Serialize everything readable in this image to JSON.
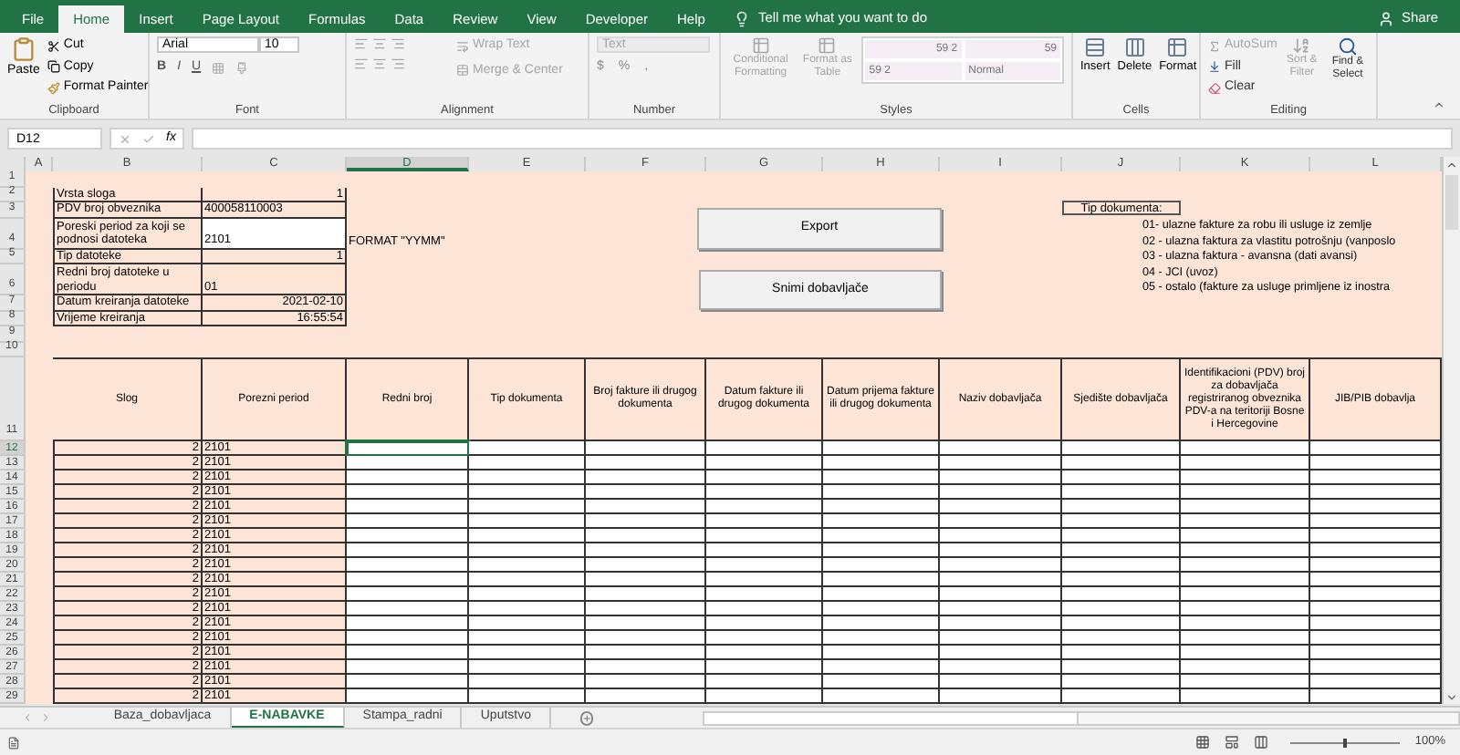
{
  "menu": [
    {
      "label": "File",
      "selected": false
    },
    {
      "label": "Home",
      "selected": true
    },
    {
      "label": "Insert",
      "selected": false
    },
    {
      "label": "Page Layout",
      "selected": false
    },
    {
      "label": "Formulas",
      "selected": false
    },
    {
      "label": "Data",
      "selected": false
    },
    {
      "label": "Review",
      "selected": false
    },
    {
      "label": "View",
      "selected": false
    },
    {
      "label": "Developer",
      "selected": false
    },
    {
      "label": "Help",
      "selected": false
    }
  ],
  "tell_me": "Tell me what you want to do",
  "share": "Share",
  "clipboard": {
    "label": "Clipboard",
    "paste": "Paste",
    "cut": "Cut",
    "copy": "Copy",
    "format_painter": "Format Painter"
  },
  "font": {
    "label": "Font",
    "name": "Arial",
    "size": "10",
    "bold": "B",
    "italic": "I",
    "underline": "U"
  },
  "alignment": {
    "label": "Alignment",
    "wrap_text": {
      "label": "Wrap Text",
      "disabled": true
    },
    "merge": {
      "label": "Merge & Center",
      "disabled": true
    }
  },
  "number": {
    "label": "Number",
    "format": {
      "label": "Text",
      "disabled": true
    },
    "currency": "$",
    "percent": "%",
    "comma": ","
  },
  "styles": {
    "label": "Styles",
    "conditional": {
      "label": "Conditional Formatting",
      "disabled": true
    },
    "format_table": {
      "label": "Format as Table",
      "disabled": true
    },
    "gallery": [
      "59 2",
      "59",
      "59 2",
      "Normal"
    ]
  },
  "cells": {
    "label": "Cells",
    "buttons": [
      "Insert",
      "Delete",
      "Format"
    ]
  },
  "editing": {
    "label": "Editing",
    "autosum": {
      "label": "AutoSum",
      "disabled": true
    },
    "fill": {
      "label": "Fill",
      "disabled": false
    },
    "clear": {
      "label": "Clear",
      "disabled": false
    },
    "sort": {
      "label": "Sort & Filter",
      "disabled": true
    },
    "find": {
      "label": "Find & Select",
      "disabled": false
    }
  },
  "formula_bar": {
    "name_box": "D12",
    "function_symbol": "fx"
  },
  "columns": [
    {
      "label": "A",
      "selected": false
    },
    {
      "label": "B",
      "selected": false
    },
    {
      "label": "C",
      "selected": false
    },
    {
      "label": "D",
      "selected": true
    },
    {
      "label": "E",
      "selected": false
    },
    {
      "label": "F",
      "selected": false
    },
    {
      "label": "G",
      "selected": false
    },
    {
      "label": "H",
      "selected": false
    },
    {
      "label": "I",
      "selected": false
    },
    {
      "label": "J",
      "selected": false
    },
    {
      "label": "K",
      "selected": false
    },
    {
      "label": "L",
      "selected": false
    }
  ],
  "top_rows": [
    {
      "row": "1"
    },
    {
      "row": "2",
      "label": "Vrsta sloga",
      "value": "1",
      "kind": "number",
      "editable": false
    },
    {
      "row": "3",
      "label": "PDV broj obveznika",
      "value": "400058110003",
      "kind": "text",
      "editable": false
    },
    {
      "row": "4",
      "label": "Poreski period za koji se podnosi datoteka",
      "value": "2101",
      "kind": "text",
      "editable": true,
      "note": "FORMAT \"YYMM\""
    },
    {
      "row": "5",
      "label": "Tip datoteke",
      "value": "1",
      "kind": "number",
      "editable": false
    },
    {
      "row": "6",
      "label": "Redni broj datoteke u periodu",
      "value": "01",
      "kind": "text",
      "editable": false
    },
    {
      "row": "7",
      "label": "Datum kreiranja datoteke",
      "value": "2021-02-10",
      "kind": "number",
      "editable": false
    },
    {
      "row": "8",
      "label": "Vrijeme kreiranja",
      "value": "16:55:54",
      "kind": "number",
      "editable": false
    },
    {
      "row": "9"
    },
    {
      "row": "10"
    }
  ],
  "buttons": [
    "Export",
    "Snimi dobavljače"
  ],
  "document_types": {
    "title": "Tip dokumenta:",
    "lines": [
      "01- ulazne fakture za robu ili usluge iz zemlje",
      "02 - ulazna faktura za vlastitu potrošnju (vanposlo",
      "03 - ulazna faktura - avansna (dati avansi)",
      "04 - JCI (uvoz)",
      "05 - ostalo (fakture za usluge primljene iz inostra"
    ]
  },
  "header_row": {
    "row": "11",
    "columns": [
      "Slog",
      "Porezni period",
      "Redni broj",
      "Tip dokumenta",
      "Broj fakture ili drugog dokumenta",
      "Datum fakture ili drugog dokumenta",
      "Datum prijema fakture ili drugog dokumenta",
      "Naziv dobavljača",
      "Sjedište dobavljača",
      "Identifikacioni (PDV) broj za dobavljača registriranog obveznika PDV-a na teritoriji Bosne i Hercegovine",
      "JIB/PIB dobavlja"
    ]
  },
  "data_rows": [
    {
      "row": "12",
      "slog": "2",
      "period": "2101",
      "selected": true
    },
    {
      "row": "13",
      "slog": "2",
      "period": "2101",
      "selected": false
    },
    {
      "row": "14",
      "slog": "2",
      "period": "2101",
      "selected": false
    },
    {
      "row": "15",
      "slog": "2",
      "period": "2101",
      "selected": false
    },
    {
      "row": "16",
      "slog": "2",
      "period": "2101",
      "selected": false
    },
    {
      "row": "17",
      "slog": "2",
      "period": "2101",
      "selected": false
    },
    {
      "row": "18",
      "slog": "2",
      "period": "2101",
      "selected": false
    },
    {
      "row": "19",
      "slog": "2",
      "period": "2101",
      "selected": false
    },
    {
      "row": "20",
      "slog": "2",
      "period": "2101",
      "selected": false
    },
    {
      "row": "21",
      "slog": "2",
      "period": "2101",
      "selected": false
    },
    {
      "row": "22",
      "slog": "2",
      "period": "2101",
      "selected": false
    },
    {
      "row": "23",
      "slog": "2",
      "period": "2101",
      "selected": false
    },
    {
      "row": "24",
      "slog": "2",
      "period": "2101",
      "selected": false
    },
    {
      "row": "25",
      "slog": "2",
      "period": "2101",
      "selected": false
    },
    {
      "row": "26",
      "slog": "2",
      "period": "2101",
      "selected": false
    },
    {
      "row": "27",
      "slog": "2",
      "period": "2101",
      "selected": false
    },
    {
      "row": "28",
      "slog": "2",
      "period": "2101",
      "selected": false
    },
    {
      "row": "29",
      "slog": "2",
      "period": "2101",
      "selected": false
    }
  ],
  "sheets": [
    {
      "label": "Baza_dobavljaca",
      "selected": false
    },
    {
      "label": "E-NABAVKE",
      "selected": true
    },
    {
      "label": "Stampa_radni",
      "selected": false
    },
    {
      "label": "Uputstvo",
      "selected": false
    }
  ],
  "zoom": "100%",
  "zoom_slider": {
    "level": 0.5
  }
}
